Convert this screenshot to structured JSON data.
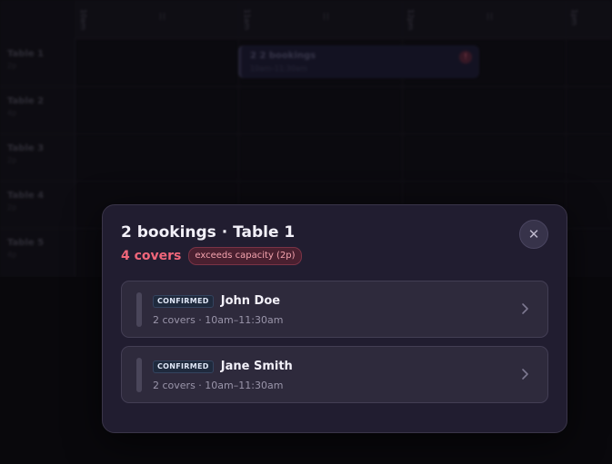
{
  "timeline": {
    "hour_labels": [
      "10am",
      "11am",
      "12pm",
      "1pm"
    ],
    "tables": [
      {
        "name": "Table 1",
        "capacity": "2p"
      },
      {
        "name": "Table 2",
        "capacity": "4p"
      },
      {
        "name": "Table 3",
        "capacity": "2p"
      },
      {
        "name": "Table 4",
        "capacity": "2p"
      },
      {
        "name": "Table 5",
        "capacity": "4p"
      }
    ],
    "block": {
      "count_icon": "2",
      "title": "2 bookings",
      "subtitle": "10am–11:30am",
      "warning_icon": "!"
    }
  },
  "modal": {
    "title": "2 bookings · Table 1",
    "close_icon": "✕",
    "covers": "4 covers",
    "capacity_badge": "exceeds capacity (2p)",
    "bookings": [
      {
        "status": "CONFIRMED",
        "name": "John Doe",
        "details": "2 covers · 10am–11:30am"
      },
      {
        "status": "CONFIRMED",
        "name": "Jane Smith",
        "details": "2 covers · 10am–11:30am"
      }
    ]
  },
  "colors": {
    "background": "#0b0a0f",
    "modal_bg": "#211d30",
    "card_bg": "#2e2a3c",
    "danger": "#f0667a"
  },
  "icons": {
    "close": "close-icon",
    "chevron": "chevron-right-icon",
    "warning": "warning-icon"
  }
}
